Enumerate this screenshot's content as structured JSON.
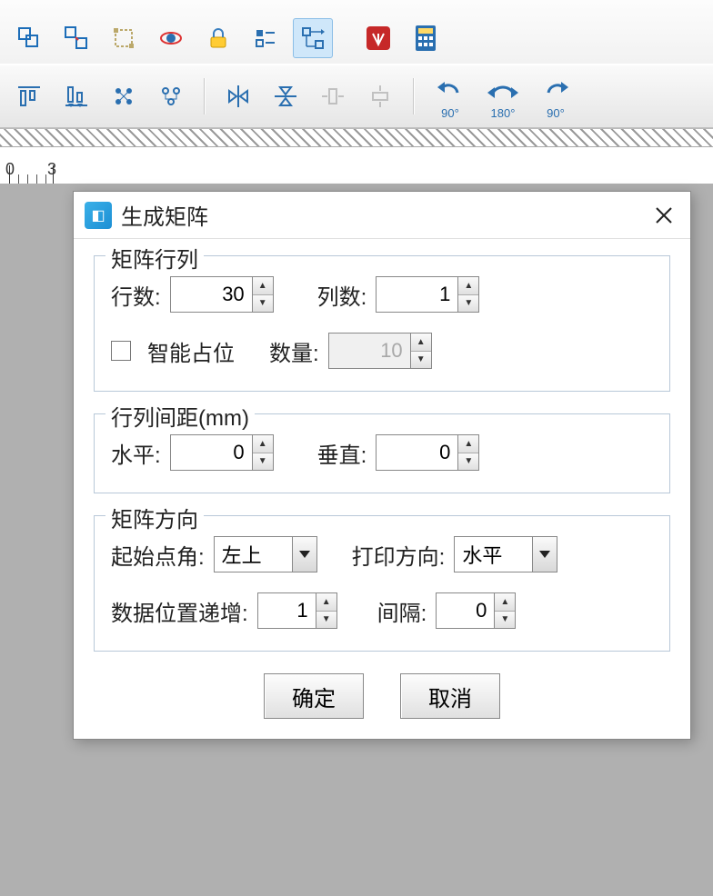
{
  "toolbar1_icons": [
    "group-icon",
    "ungroup-icon",
    "transform-icon",
    "rotate-3d-icon",
    "lock-icon",
    "list-toggle-icon",
    "flow-icon",
    "pdf-icon",
    "calculator-icon"
  ],
  "toolbar2_icons": [
    "align-top-icon",
    "align-bottom-icon",
    "distribute-h-icon",
    "distribute-v-icon",
    "sep",
    "mirror-h-icon",
    "mirror-v-icon",
    "fit-width-icon",
    "fit-height-icon",
    "sep2"
  ],
  "rotate_labels": {
    "left90": "90°",
    "half": "180°",
    "right90": "90°"
  },
  "dialog": {
    "title": "生成矩阵",
    "sections": {
      "matrix": {
        "legend": "矩阵行列",
        "rows_label": "行数:",
        "rows_value": "30",
        "cols_label": "列数:",
        "cols_value": "1",
        "smart_label": "智能占位",
        "qty_label": "数量:",
        "qty_value": "10"
      },
      "spacing": {
        "legend": "行列间距(mm)",
        "h_label": "水平:",
        "h_value": "0",
        "v_label": "垂直:",
        "v_value": "0"
      },
      "direction": {
        "legend": "矩阵方向",
        "start_label": "起始点角:",
        "start_value": "左上",
        "print_label": "打印方向:",
        "print_value": "水平",
        "incr_label": "数据位置递增:",
        "incr_value": "1",
        "gap_label": "间隔:",
        "gap_value": "0"
      }
    },
    "buttons": {
      "ok": "确定",
      "cancel": "取消"
    }
  }
}
